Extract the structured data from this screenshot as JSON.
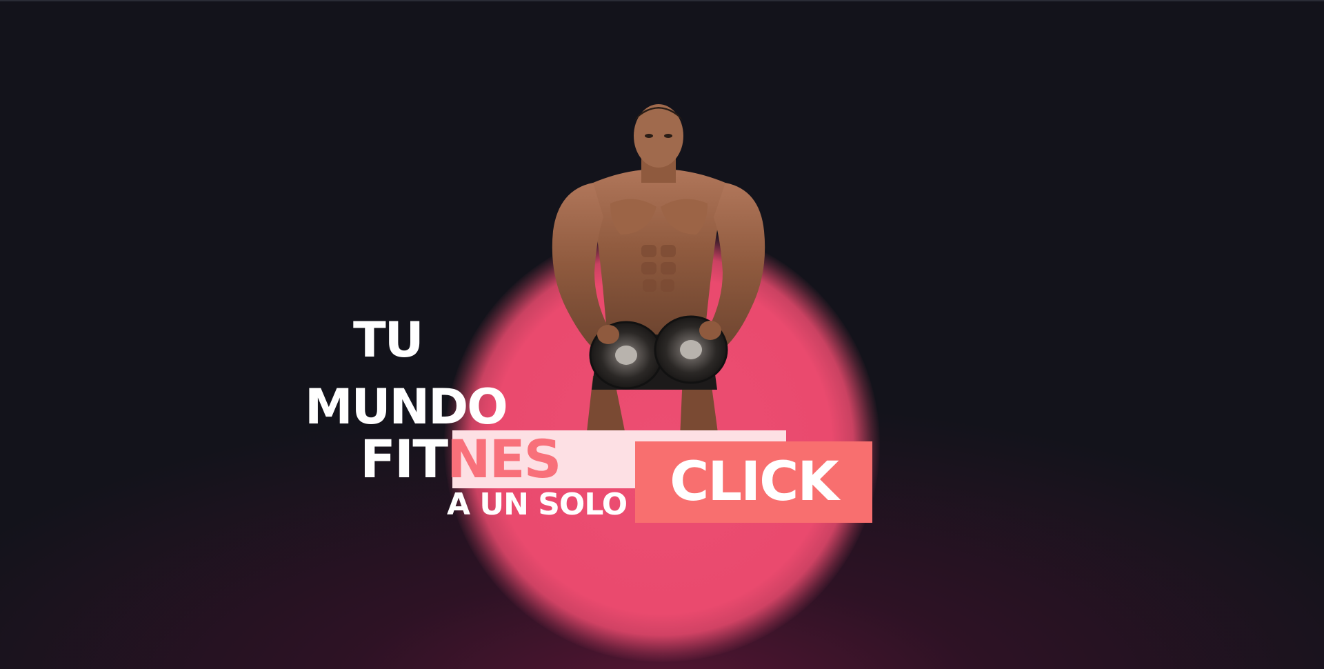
{
  "hero": {
    "line1": "TU",
    "line2": "MUNDO",
    "line3_part1": "FIT",
    "line3_part2": "NES",
    "line4": "A UN SOLO",
    "cta_label": "CLICK"
  },
  "colors": {
    "background": "#13131b",
    "accent_pink": "#ea4a6e",
    "cta": "#f86f6f",
    "highlight": "#fde0e4",
    "highlight_text": "#f8707a"
  },
  "image": {
    "subject": "bodybuilder-holding-dumbbells"
  }
}
